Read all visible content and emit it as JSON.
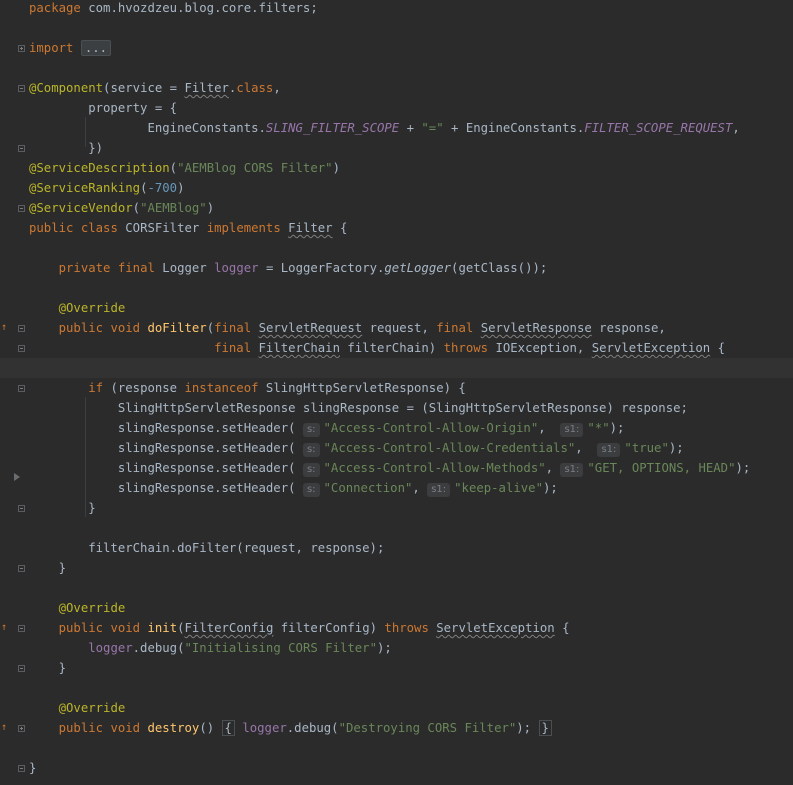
{
  "editor": {
    "language": "Java",
    "lines": [
      {
        "t": "package com.hvozdzeu.blog.core.filters;"
      },
      {
        "t": ""
      },
      {
        "t": "import ..."
      },
      {
        "t": ""
      },
      {
        "t": "@Component(service = Filter.class,"
      },
      {
        "t": "        property = {"
      },
      {
        "t": "                EngineConstants.SLING_FILTER_SCOPE + \"=\" + EngineConstants.FILTER_SCOPE_REQUEST,"
      },
      {
        "t": "        })"
      },
      {
        "t": "@ServiceDescription(\"AEMBlog CORS Filter\")"
      },
      {
        "t": "@ServiceRanking(-700)"
      },
      {
        "t": "@ServiceVendor(\"AEMBlog\")"
      },
      {
        "t": "public class CORSFilter implements Filter {"
      },
      {
        "t": ""
      },
      {
        "t": "    private final Logger logger = LoggerFactory.getLogger(getClass());"
      },
      {
        "t": ""
      },
      {
        "t": "    @Override"
      },
      {
        "t": "    public void doFilter(final ServletRequest request, final ServletResponse response,"
      },
      {
        "t": "                         final FilterChain filterChain) throws IOException, ServletException {"
      },
      {
        "t": ""
      },
      {
        "t": "        if (response instanceof SlingHttpServletResponse) {"
      },
      {
        "t": "            SlingHttpServletResponse slingResponse = (SlingHttpServletResponse) response;"
      },
      {
        "t": "            slingResponse.setHeader( s: \"Access-Control-Allow-Origin\",  s1: \"*\");"
      },
      {
        "t": "            slingResponse.setHeader( s: \"Access-Control-Allow-Credentials\",  s1: \"true\");"
      },
      {
        "t": "            slingResponse.setHeader( s: \"Access-Control-Allow-Methods\", s1: \"GET, OPTIONS, HEAD\");"
      },
      {
        "t": "            slingResponse.setHeader( s: \"Connection\", s1: \"keep-alive\");"
      },
      {
        "t": "        }"
      },
      {
        "t": ""
      },
      {
        "t": "        filterChain.doFilter(request, response);"
      },
      {
        "t": "    }"
      },
      {
        "t": ""
      },
      {
        "t": "    @Override"
      },
      {
        "t": "    public void init(FilterConfig filterConfig) throws ServletException {"
      },
      {
        "t": "        logger.debug(\"Initialising CORS Filter\");"
      },
      {
        "t": "    }"
      },
      {
        "t": ""
      },
      {
        "t": "    @Override"
      },
      {
        "t": "    public void destroy() { logger.debug(\"Destroying CORS Filter\"); }"
      },
      {
        "t": ""
      },
      {
        "t": "}"
      }
    ],
    "current_line_index": 18,
    "colors": {
      "background": "#2b2b2b",
      "default_text": "#a9b7c6",
      "keyword": "#cc7832",
      "annotation": "#bbb529",
      "string": "#6a8759",
      "number": "#6897bb",
      "method_declaration": "#ffc66d",
      "field": "#9876aa"
    }
  }
}
